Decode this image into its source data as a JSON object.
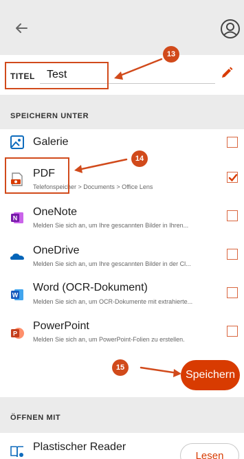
{
  "icons": {
    "back": "arrow-left",
    "profile": "user-circle",
    "edit": "pencil"
  },
  "title_field": {
    "label": "TITEL",
    "value": "Test"
  },
  "save_section": {
    "header": "SPEICHERN UNTER",
    "items": [
      {
        "title": "Galerie",
        "subtitle": "",
        "checked": false,
        "icon": "gallery-icon"
      },
      {
        "title": "PDF",
        "subtitle": "Telefonspeicher > Documents > Office Lens",
        "checked": true,
        "icon": "pdf-icon"
      },
      {
        "title": "OneNote",
        "subtitle": "Melden Sie sich an, um Ihre gescannten Bilder in Ihren...",
        "checked": false,
        "icon": "onenote-icon"
      },
      {
        "title": "OneDrive",
        "subtitle": "Melden Sie sich an, um Ihre gescannten Bilder in der Cl...",
        "checked": false,
        "icon": "onedrive-icon"
      },
      {
        "title": "Word (OCR-Dokument)",
        "subtitle": "Melden Sie sich an, um OCR-Dokumente mit extrahierte...",
        "checked": false,
        "icon": "word-icon"
      },
      {
        "title": "PowerPoint",
        "subtitle": "Melden Sie sich an, um PowerPoint-Folien zu erstellen.",
        "checked": false,
        "icon": "powerpoint-icon"
      }
    ],
    "save_label": "Speichern"
  },
  "open_section": {
    "header": "ÖFFNEN MIT",
    "items": [
      {
        "title": "Plastischer Reader",
        "action_label": "Lesen",
        "icon": "immersive-reader-icon"
      }
    ]
  },
  "annotations": {
    "steps": [
      "13",
      "14",
      "15"
    ],
    "color": "#d14a1b"
  },
  "colors": {
    "accent": "#d83b01",
    "header_bg": "#ebebeb",
    "onenote": "#7719aa",
    "onedrive": "#0364b8",
    "word": "#185abd",
    "powerpoint": "#c43e1c"
  }
}
